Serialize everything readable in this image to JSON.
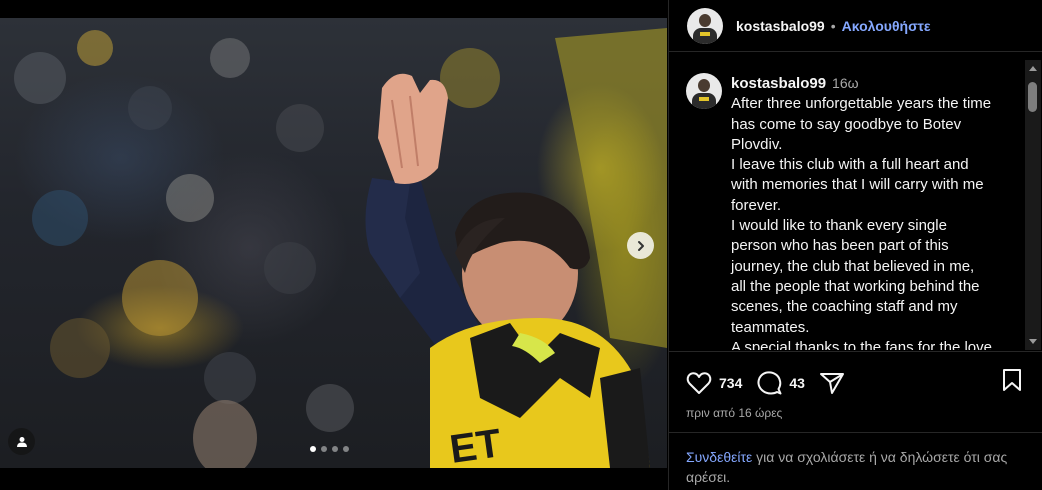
{
  "post": {
    "username": "kostasbalo99",
    "follow_label": "Ακολουθήστε",
    "separator": "•",
    "caption_time": "16ω",
    "caption_lines": [
      "After three unforgettable years the time",
      "has come to say goodbye to Botev",
      "Plovdiv.",
      "I leave this club with a full heart and",
      "with memories that I will carry with me",
      "forever.",
      "I would like to thank every single",
      "person who has been part of this",
      "journey, the club that believed in me,",
      "all the people that working behind the",
      "scenes, the coaching staff and my",
      "teammates.",
      "A special thanks to the fans for the love"
    ],
    "likes": "734",
    "comments": "43",
    "posted_ago": "πριν από 16 ώρες",
    "login_link": "Συνδεθείτε",
    "login_text": " για να σχολιάσετε ή να δηλώσετε ότι σας αρέσει.",
    "carousel_count": 4,
    "carousel_active": 0
  },
  "icons": {
    "like": "heart-icon",
    "comment": "comment-bubble-icon",
    "share": "share-plane-icon",
    "save": "bookmark-icon",
    "next": "chevron-right-icon",
    "tag": "user-tag-icon"
  },
  "colors": {
    "background": "#000000",
    "link": "#85a8ff",
    "secondary_text": "#a8a8a8",
    "jersey_yellow": "#e8c81c"
  }
}
